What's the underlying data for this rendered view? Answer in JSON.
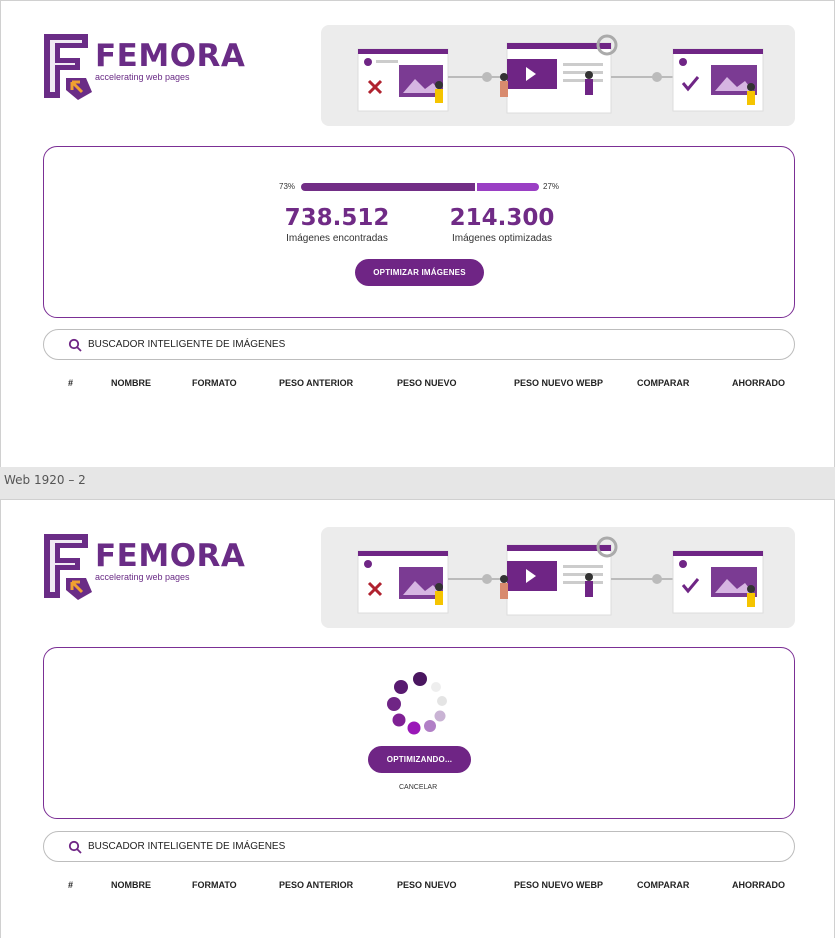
{
  "brand": {
    "name": "FEMORA",
    "tagline": "accelerating web pages",
    "color": "#6a2c86"
  },
  "frame_label": "Web 1920 – 2",
  "screen1": {
    "progress": {
      "found_pct_label": "73%",
      "optimized_pct_label": "27%",
      "found_fraction": 0.73,
      "optimized_fraction": 0.27
    },
    "stats": {
      "found_value": "738.512",
      "found_label": "Imágenes encontradas",
      "optimized_value": "214.300",
      "optimized_label": "Imágenes optimizadas"
    },
    "optimize_button": "OPTIMIZAR IMÁGENES",
    "search_placeholder": "BUSCADOR INTELIGENTE DE IMÁGENES"
  },
  "screen2": {
    "optimizing_button": "OPTIMIZANDO...",
    "cancel_label": "CANCELAR",
    "search_placeholder": "BUSCADOR INTELIGENTE DE IMÁGENES"
  },
  "table": {
    "columns": [
      "#",
      "NOMBRE",
      "FORMATO",
      "PESO ANTERIOR",
      "PESO NUEVO",
      "PESO NUEVO WEBP",
      "COMPARAR",
      "AHORRADO"
    ]
  },
  "colors": {
    "accent": "#6f2585",
    "accent_light": "#9a3fc4",
    "border": "#7b2f95"
  }
}
